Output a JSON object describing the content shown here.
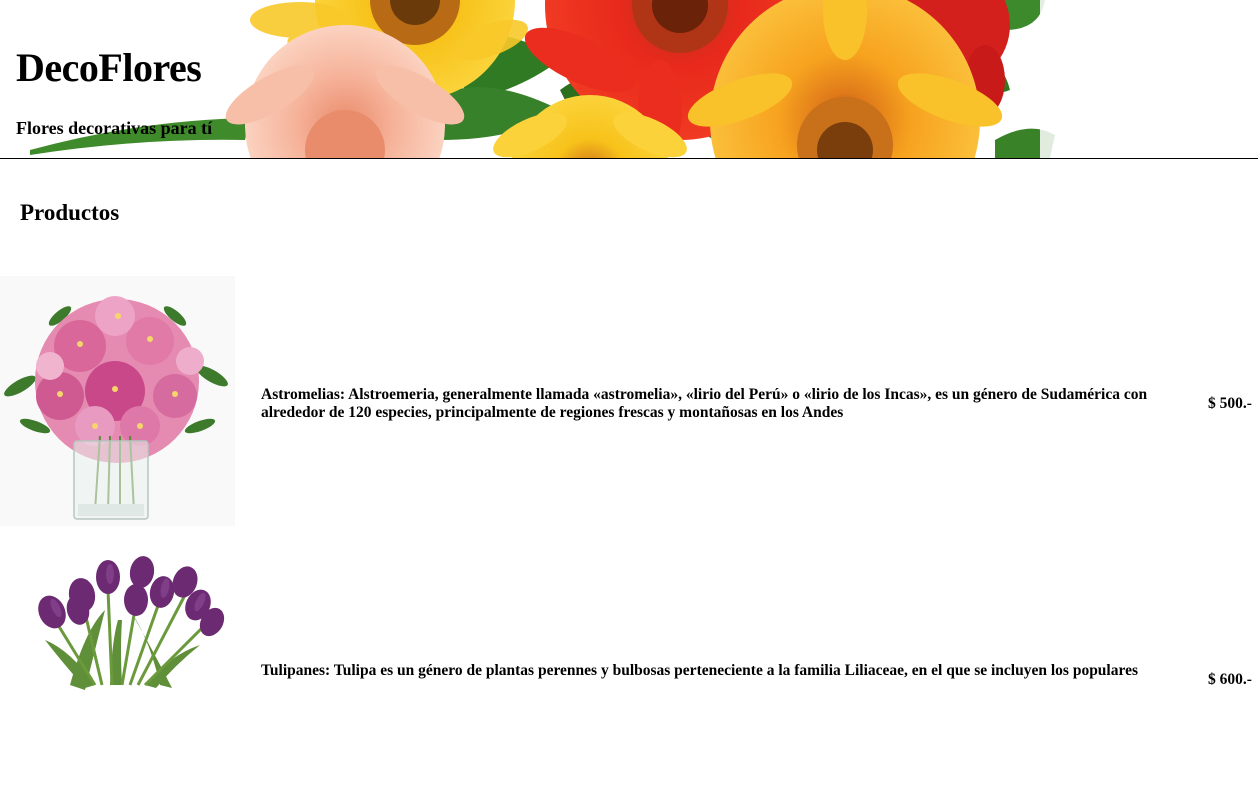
{
  "header": {
    "title": "DecoFlores",
    "tagline": "Flores decorativas para tí"
  },
  "section": {
    "title": "Productos"
  },
  "products": [
    {
      "description": "Astromelias: Alstroemeria, generalmente llamada «astromelia», «lirio del Perú» o «lirio de los Incas», es un género de Sudamérica con alrededor de 120 especies, principalmente de regiones frescas y montañosas en los Andes",
      "price": "$ 500.-",
      "image": "astromelia-bouquet-image"
    },
    {
      "description": "Tulipanes: Tulipa es un género de plantas perennes y bulbosas perteneciente a la familia Liliaceae, en el que se incluyen los populares",
      "price": "$ 600.-",
      "image": "tulip-bouquet-image"
    }
  ],
  "colors": {
    "gerbera_red": "#e8291c",
    "gerbera_yellow": "#f7c21a",
    "gerbera_orange": "#f59a1f",
    "gerbera_peach": "#f6b39a",
    "leaf_green": "#2f7a22",
    "astromelia_pink": "#d9679a",
    "tulip_purple": "#6b2a72"
  }
}
